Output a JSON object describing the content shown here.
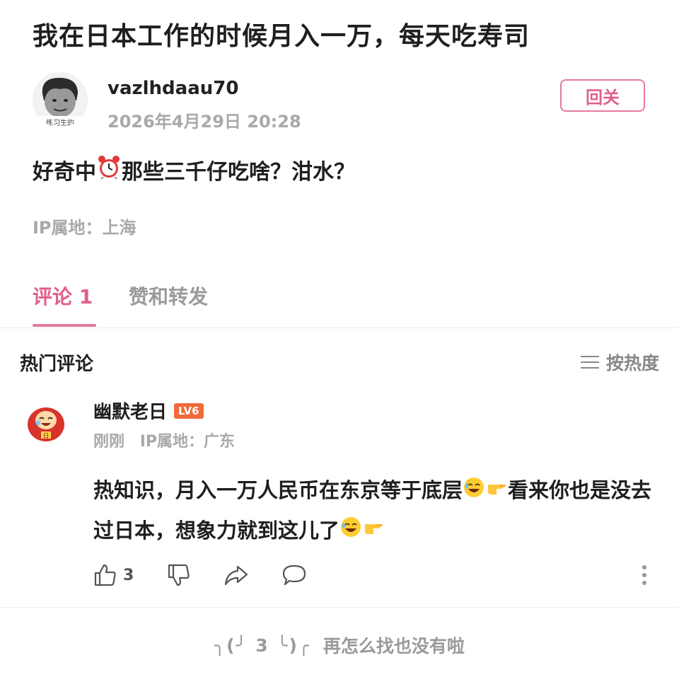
{
  "post": {
    "title": "我在日本工作的时候月入一万，每天吃寿司",
    "author": {
      "name": "vazlhdaau70",
      "time": "2026年4月29日 20:28",
      "avatar_icon": "meme-face-avatar",
      "avatar_caption": "练习生的"
    },
    "follow_label": "回关",
    "body_before": "好奇中",
    "body_emoji": "alarm-clock-icon",
    "body_after": "那些三千仔吃啥？泔水？",
    "ip_location": "IP属地：上海"
  },
  "tabs": {
    "comments_label": "评论 1",
    "reposts_label": "赞和转发"
  },
  "comments_section": {
    "title": "热门评论",
    "sort_label": "按热度"
  },
  "comment": {
    "user": "幽默老日",
    "level": "LV6",
    "time": "刚刚",
    "ip": "IP属地：广东",
    "text_part1": "热知识，月入一万人民币在东京等于底层",
    "text_part2": "看来你也是没去过日本，想象力就到这儿了",
    "likes": "3"
  },
  "footer": {
    "kaomoji": "╮(╯ 3 ╰)╭",
    "end_text": "再怎么找也没有啦"
  },
  "colors": {
    "accent": "#e05f8c",
    "muted": "#a9a9a9",
    "level_badge": "#f26a3a"
  }
}
